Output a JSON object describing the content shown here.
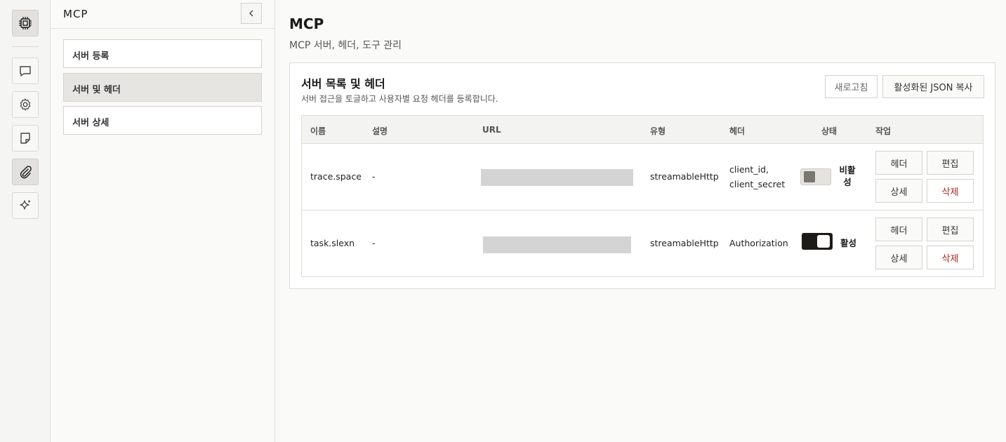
{
  "rail": {
    "items": [
      {
        "icon": "chip-icon"
      },
      {
        "icon": "chat-icon"
      },
      {
        "icon": "gear-icon"
      },
      {
        "icon": "note-icon"
      },
      {
        "icon": "paperclip-icon"
      },
      {
        "icon": "sparkle-icon"
      }
    ]
  },
  "sidebar": {
    "title": "MCP",
    "items": [
      {
        "label": "서버 등록"
      },
      {
        "label": "서버 및 헤더"
      },
      {
        "label": "서버 상세"
      }
    ],
    "active_index": 1
  },
  "main": {
    "title": "MCP",
    "subtitle": "MCP 서버, 헤더, 도구 관리"
  },
  "card": {
    "title": "서버 목록 및 헤더",
    "description": "서버 접근을 토글하고 사용자별 요청 헤더를 등록합니다.",
    "refresh_label": "새로고침",
    "copy_label": "활성화된 JSON 복사"
  },
  "table": {
    "columns": [
      "이름",
      "설명",
      "URL",
      "유형",
      "헤더",
      "상태",
      "작업"
    ],
    "rows": [
      {
        "name": "trace.space",
        "description": "-",
        "type": "streamableHttp",
        "headers_line1": "client_id,",
        "headers_line2": "client_secret",
        "active": false,
        "status_line1": "비활",
        "status_line2": "성"
      },
      {
        "name": "task.slexn",
        "description": "-",
        "type": "streamableHttp",
        "headers_line1": "Authorization",
        "headers_line2": "",
        "active": true,
        "status_line1": "활성",
        "status_line2": ""
      }
    ],
    "actions": {
      "header": "헤더",
      "edit": "편집",
      "detail": "상세",
      "delete": "삭제"
    }
  },
  "colors": {
    "danger": "#b3261e",
    "toggle_on": "#1e1a17",
    "active_nav": "#e6e5e2"
  }
}
